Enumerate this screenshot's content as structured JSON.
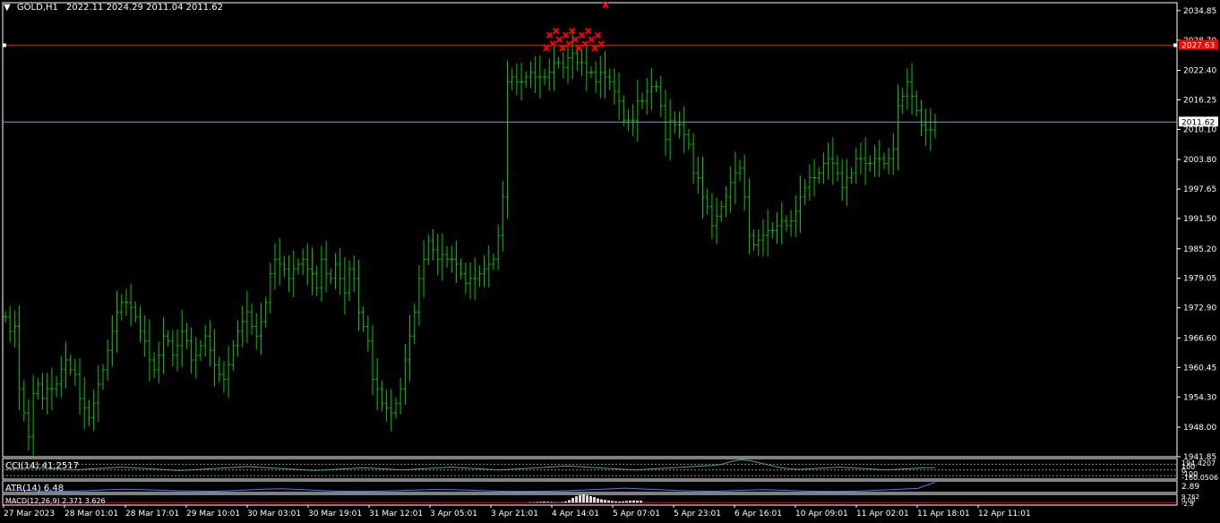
{
  "header": {
    "menu_glyph": "▼",
    "symbol": "GOLD,H1",
    "ohlc": "2022.11 2024.29 2011.04 2011.62"
  },
  "colors": {
    "background": "#000000",
    "frame": "#ffffff",
    "bars": "#00c800",
    "marker": "#ff0000",
    "hline_red": "#ff0000",
    "hline_blue": "#7f9fd0",
    "cci_line": "#4aa0a0",
    "atr_line": "#3f7fff",
    "label_text": "#ffffff"
  },
  "chart_data": [
    {
      "type": "ohlc",
      "symbol": "GOLD",
      "timeframe": "H1",
      "ylim": [
        1941.85,
        2036.5
      ],
      "y_ticks": [
        "2034.85",
        "2028.70",
        "2022.40",
        "2016.25",
        "2010.10",
        "2003.80",
        "1997.65",
        "1991.50",
        "1985.20",
        "1979.05",
        "1972.90",
        "1966.60",
        "1960.45",
        "1954.30",
        "1948.00",
        "1941.85"
      ],
      "x_ticks": [
        "27 Mar 2023",
        "28 Mar 01:01",
        "28 Mar 17:01",
        "29 Mar 10:01",
        "30 Mar 03:01",
        "30 Mar 19:01",
        "31 Mar 12:01",
        "3 Apr 05:01",
        "3 Apr 21:01",
        "4 Apr 14:01",
        "5 Apr 07:01",
        "5 Apr 23:01",
        "6 Apr 16:01",
        "10 Apr 09:01",
        "11 Apr 02:01",
        "11 Apr 18:01",
        "12 Apr 11:01"
      ],
      "closes": [
        1971,
        1968,
        1969,
        1956,
        1951,
        1946,
        1955,
        1957,
        1954,
        1956,
        1956,
        1957,
        1960,
        1962,
        1960,
        1959,
        1954,
        1952,
        1950,
        1953,
        1957,
        1960,
        1964,
        1968,
        1972,
        1974,
        1974,
        1973,
        1971,
        1968,
        1966,
        1962,
        1960,
        1963,
        1967,
        1966,
        1963,
        1965,
        1968,
        1966,
        1962,
        1963,
        1965,
        1967,
        1964,
        1961,
        1959,
        1958,
        1961,
        1965,
        1968,
        1970,
        1972,
        1969,
        1967,
        1970,
        1974,
        1980,
        1983,
        1982,
        1981,
        1979,
        1981,
        1982,
        1983,
        1981,
        1980,
        1977,
        1983,
        1980,
        1979,
        1982,
        1979,
        1976,
        1981,
        1979,
        1972,
        1969,
        1966,
        1958,
        1956,
        1953,
        1952,
        1951,
        1953,
        1956,
        1962,
        1967,
        1972,
        1979,
        1983,
        1987,
        1985,
        1983,
        1984,
        1983,
        1983,
        1982,
        1980,
        1978,
        1979,
        1979,
        1980,
        1981,
        1982,
        1983,
        1988,
        1996,
        2020,
        2021,
        2020,
        2020,
        2021,
        2022,
        2021,
        2021,
        2021,
        2022,
        2024,
        2024,
        2023,
        2025,
        2026,
        2024,
        2024,
        2022,
        2022,
        2020,
        2022,
        2021,
        2020,
        2018,
        2016,
        2012,
        2012,
        2012,
        2016,
        2016,
        2018,
        2019,
        2019,
        2015,
        2008,
        2012,
        2011,
        2011,
        2009,
        2007,
        2001,
        2000,
        1996,
        1994,
        1990,
        1992,
        1994,
        1996,
        1999,
        2001,
        2002,
        1996,
        1988,
        1986,
        1987,
        1988,
        1989,
        1989,
        1990,
        1991,
        1990,
        1991,
        1993,
        1996,
        1998,
        2000,
        2000,
        2001,
        2003,
        2004,
        2003,
        2001,
        1998,
        2000,
        2001,
        2004,
        2004,
        2003,
        2003,
        2004,
        2004,
        2003,
        2004,
        2006,
        2015,
        2017,
        2020,
        2017,
        2014,
        2011,
        2010,
        2010,
        2011.62
      ],
      "sell_markers_count": 18,
      "price_lines": [
        {
          "price": 2027.63,
          "label": "2027.63",
          "color": "red"
        },
        {
          "price": 2011.62,
          "label": "2011.62",
          "color": "blue"
        }
      ]
    },
    {
      "type": "line",
      "name": "CCI(14)",
      "title": "CCI(14) 41.2517",
      "y_labels": [
        "194.4207",
        "100",
        "0",
        "-100",
        "-160.0506"
      ],
      "values": [
        10,
        20,
        30,
        40,
        30,
        20,
        10,
        0,
        10,
        20,
        30,
        40,
        50,
        40,
        30,
        20,
        10,
        0,
        -10,
        0,
        10,
        20,
        30,
        40,
        50,
        60,
        50,
        40,
        30,
        20,
        10,
        0,
        -10,
        0,
        10,
        20,
        30,
        40,
        30,
        20,
        10,
        0,
        10,
        20,
        30,
        40,
        50,
        40,
        30,
        20,
        10,
        0,
        10,
        20,
        30,
        40,
        50,
        60,
        70,
        60,
        50,
        40,
        30,
        20,
        10,
        0,
        10,
        20,
        30,
        40,
        50,
        60,
        70,
        80,
        100,
        150,
        180,
        160,
        120,
        80,
        40,
        20,
        10,
        20,
        30,
        40,
        50,
        40,
        30,
        20,
        10,
        0,
        10,
        20,
        30,
        40,
        41
      ]
    },
    {
      "type": "line",
      "name": "ATR(14)",
      "title": "ATR(14) 6.48",
      "y_labels": [
        "2.89"
      ],
      "values": [
        3.5,
        3.4,
        3.2,
        3.0,
        3.1,
        3.3,
        3.6,
        3.8,
        3.6,
        3.4,
        3.2,
        3.1,
        3.0,
        3.2,
        3.5,
        3.8,
        4.0,
        3.7,
        3.4,
        3.1,
        3.0,
        3.0,
        3.1,
        3.3,
        3.5,
        3.7,
        3.6,
        3.4,
        3.2,
        3.0,
        2.9,
        3.0,
        3.1,
        3.3,
        3.6,
        3.9,
        4.2,
        3.9,
        3.6,
        3.3,
        3.1,
        3.0,
        3.2,
        3.4,
        3.6,
        3.4,
        3.2,
        3.0,
        2.9,
        3.0,
        3.2,
        3.5,
        3.8,
        4.1,
        6.48
      ]
    },
    {
      "type": "bar",
      "name": "MACD",
      "title": "MACD(12,26,9) 2.371 3.626",
      "y_labels": [
        "9.762",
        "0.00",
        "-2.9"
      ],
      "values": [
        0.5,
        0.6,
        0.8,
        1.0,
        1.2,
        1.0,
        0.8,
        0.6,
        0.5,
        0.8,
        1.5,
        3.0,
        5.5,
        7.5,
        8.8,
        9.2,
        8.5,
        7.6,
        6.5,
        5.0,
        4.0,
        3.2,
        2.6,
        2.0,
        1.6,
        1.4,
        1.6,
        2.0,
        2.4,
        2.6,
        2.4,
        2.3
      ]
    }
  ],
  "subwindow_labels": {
    "cci": "CCI(14) 41.2517",
    "atr": "ATR(14) 6.48",
    "macd": "MACD(12,26,9) 2.371 3.626"
  }
}
